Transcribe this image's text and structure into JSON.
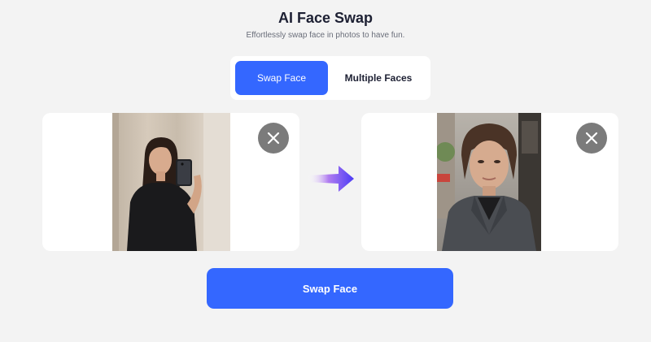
{
  "header": {
    "title": "AI Face Swap",
    "subtitle": "Effortlessly swap face in photos to have fun."
  },
  "tabs": [
    {
      "label": "Swap Face",
      "active": true
    },
    {
      "label": "Multiple Faces",
      "active": false
    }
  ],
  "source_panel": {
    "image": "woman taking mirror selfie",
    "remove_icon": "close-icon"
  },
  "target_panel": {
    "image": "woman portrait in blazer on street",
    "remove_icon": "close-icon"
  },
  "arrow_icon": "arrow-right-gradient-icon",
  "action": {
    "swap_label": "Swap Face"
  },
  "colors": {
    "accent": "#3467ff",
    "background": "#f3f3f3",
    "remove_button": "#7b7b7b"
  }
}
